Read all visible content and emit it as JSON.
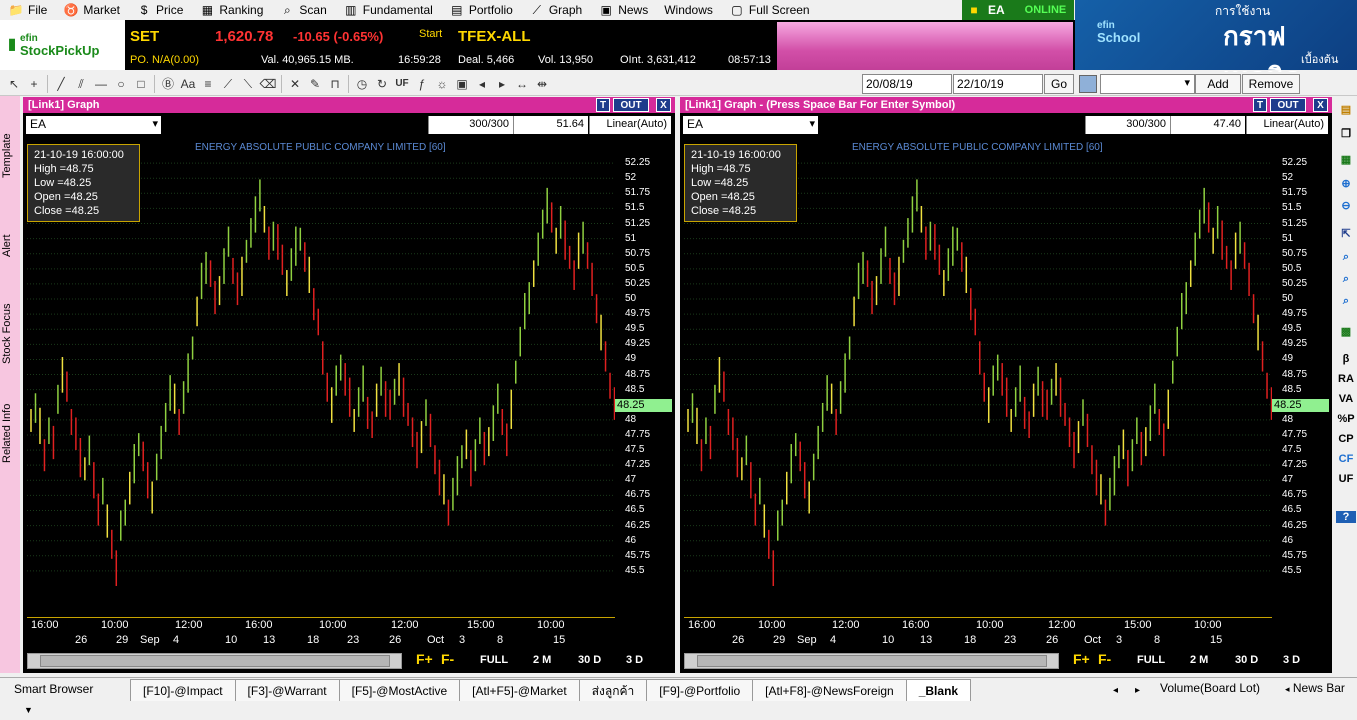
{
  "menu": [
    {
      "label": "File",
      "icon": "folder-icon"
    },
    {
      "label": "Market",
      "icon": "bull-icon"
    },
    {
      "label": "Price",
      "icon": "dollar-icon"
    },
    {
      "label": "Ranking",
      "icon": "ranking-icon"
    },
    {
      "label": "Scan",
      "icon": "scan-icon"
    },
    {
      "label": "Fundamental",
      "icon": "fundamental-icon"
    },
    {
      "label": "Portfolio",
      "icon": "portfolio-icon"
    },
    {
      "label": "Graph",
      "icon": "graph-icon"
    },
    {
      "label": "News",
      "icon": "news-icon"
    },
    {
      "label": "Windows",
      "icon": ""
    },
    {
      "label": "Full Screen",
      "icon": "fullscreen-icon"
    }
  ],
  "status": {
    "symbol": "EA",
    "connection": "ONLINE"
  },
  "brand": {
    "logo_top": "efin",
    "logo_bottom": "StockPickUp"
  },
  "set": {
    "label": "SET",
    "value": "1,620.78",
    "change": "-10.65 (-0.65%)",
    "session": "Start",
    "po": "PO. N/A(0.00)",
    "val": "Val. 40,965.15 MB.",
    "time": "16:59:28"
  },
  "tfex": {
    "label": "TFEX-ALL",
    "deal": "Deal. 5,466",
    "vol": "Vol. 13,950",
    "oint": "OInt. 3,631,412",
    "time": "08:57:13"
  },
  "ad": {
    "brand_top": "efin",
    "brand_bottom": "School",
    "line1": "การใช้งาน",
    "line2": "กราฟเทคนิค",
    "line3": "เบื้องต้น"
  },
  "toolbar": {
    "date_from": "20/08/19",
    "date_to": "22/10/19",
    "go_label": "Go",
    "add_label": "Add",
    "remove_label": "Remove"
  },
  "sidebar": {
    "tabs": [
      "Template",
      "Alert",
      "Stock Focus",
      "Related Info"
    ]
  },
  "panels": [
    {
      "title": "[Link1] Graph",
      "symbol": "EA",
      "count": "300/300",
      "last": "51.64",
      "scale": "Linear(Auto)",
      "chart_title": "ENERGY ABSOLUTE PUBLIC COMPANY LIMITED [60]",
      "ohlc_time": "21-10-19 16:00:00",
      "ohlc_high": "High =48.75",
      "ohlc_low": "Low =48.25",
      "ohlc_open": "Open =48.25",
      "ohlc_close": "Close =48.25",
      "price_tag": "48.25"
    },
    {
      "title": "[Link1] Graph - (Press Space Bar For Enter Symbol)",
      "symbol": "EA",
      "count": "300/300",
      "last": "47.40",
      "scale": "Linear(Auto)",
      "chart_title": "ENERGY ABSOLUTE PUBLIC COMPANY LIMITED [60]",
      "ohlc_time": "21-10-19 16:00:00",
      "ohlc_high": "High =48.75",
      "ohlc_low": "Low =48.25",
      "ohlc_open": "Open =48.25",
      "ohlc_close": "Close =48.25",
      "price_tag": "48.25"
    }
  ],
  "panel_controls": {
    "t": "T",
    "out": "OUT",
    "close": "X"
  },
  "y_ticks": [
    "52.25",
    "52",
    "51.75",
    "51.5",
    "51.25",
    "51",
    "50.75",
    "50.5",
    "50.25",
    "50",
    "49.75",
    "49.5",
    "49.25",
    "49",
    "48.75",
    "48.5",
    "48.25",
    "48",
    "47.75",
    "47.5",
    "47.25",
    "47",
    "46.75",
    "46.5",
    "46.25",
    "46",
    "45.75",
    "45.5"
  ],
  "x_ticks_time": [
    "16:00",
    "10:00",
    "12:00",
    "16:00",
    "10:00",
    "12:00",
    "15:00",
    "10:00"
  ],
  "x_ticks_date": [
    "26",
    "29",
    "Sep",
    "4",
    "10",
    "13",
    "18",
    "23",
    "26",
    "Oct",
    "3",
    "8",
    "15"
  ],
  "range_buttons": [
    "FULL",
    "2 M",
    "30 D",
    "3 D"
  ],
  "fplus_labels": [
    "F+",
    "F-"
  ],
  "right_tools": [
    "β",
    "RA",
    "VA",
    "%P",
    "CP",
    "CF",
    "UF"
  ],
  "taskbar": {
    "smart_browser": "Smart Browser",
    "tabs": [
      "[F10]-@Impact",
      "[F3]-@Warrant",
      "[F5]-@MostActive",
      "[Atl+F5]-@Market",
      "ส่งลูกค้า",
      "[F9]-@Portfolio",
      "[Atl+F8]-@NewsForeign",
      "_Blank"
    ],
    "active_tab": "_Blank",
    "volume": "Volume(Board Lot)",
    "news": "News Bar"
  },
  "chart_data": {
    "type": "ohlc",
    "symbol": "EA",
    "title": "ENERGY ABSOLUTE PUBLIC COMPANY LIMITED [60]",
    "ylim": [
      45.25,
      52.5
    ],
    "series": [
      {
        "values": [
          48.0,
          48.2,
          47.9,
          47.5,
          47.8,
          47.6,
          48.4,
          48.8,
          48.5,
          48.0,
          47.8,
          47.4,
          47.2,
          47.5,
          47.0,
          46.6,
          46.8,
          46.3,
          46.0,
          45.6,
          46.2,
          46.5,
          46.9,
          47.3,
          47.6,
          47.4,
          47.0,
          46.8,
          47.2,
          47.6,
          48.1,
          48.5,
          48.3,
          48.0,
          48.4,
          48.8,
          49.2,
          49.8,
          50.3,
          50.6,
          50.4,
          50.0,
          50.2,
          50.6,
          50.9,
          50.5,
          50.2,
          50.4,
          50.8,
          51.1,
          51.4,
          51.8,
          51.3,
          50.9,
          51.1,
          51.0,
          50.6,
          50.3,
          50.6,
          50.9,
          51.0,
          50.7,
          50.4,
          50.0,
          49.6,
          49.0,
          48.6,
          48.3,
          48.6,
          48.9,
          48.7,
          48.4,
          48.0,
          48.3,
          48.6,
          48.2,
          47.9,
          48.3,
          48.7,
          48.4,
          48.2,
          48.5,
          48.7,
          48.4,
          48.1,
          47.8,
          47.5,
          47.8,
          48.1,
          47.8,
          47.4,
          47.1,
          46.8,
          46.5,
          46.8,
          47.1,
          47.4,
          47.6,
          47.2,
          47.5,
          47.8,
          47.5,
          47.7,
          48.0,
          48.3,
          48.0,
          47.7,
          48.2,
          48.8,
          49.3,
          49.8,
          50.1,
          50.4,
          50.8,
          51.3,
          51.6,
          51.3,
          51.0,
          51.3,
          51.0,
          50.7,
          50.4,
          50.8,
          51.1,
          50.7,
          50.3,
          49.9,
          49.5,
          49.0,
          48.6,
          48.3
        ]
      }
    ]
  }
}
